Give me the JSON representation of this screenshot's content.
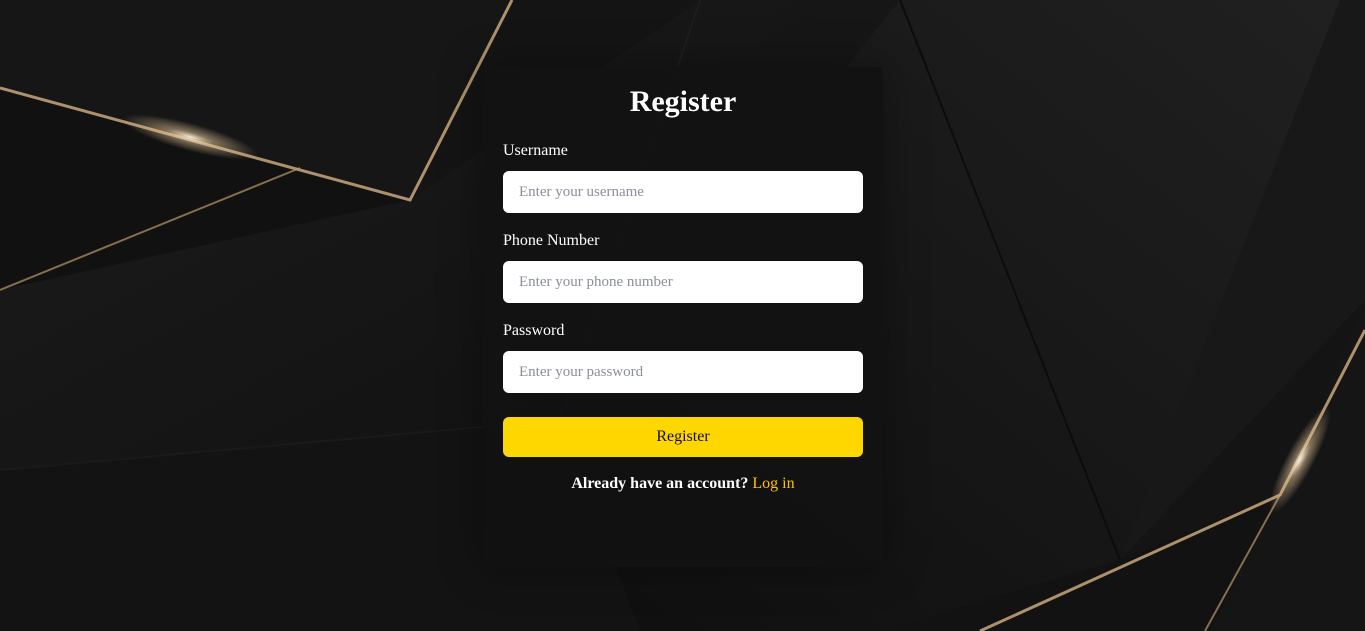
{
  "form": {
    "title": "Register",
    "username": {
      "label": "Username",
      "placeholder": "Enter your username",
      "value": ""
    },
    "phone": {
      "label": "Phone Number",
      "placeholder": "Enter your phone number",
      "value": ""
    },
    "password": {
      "label": "Password",
      "placeholder": "Enter your password",
      "value": ""
    },
    "submit_label": "Register",
    "footer_text": "Already have an account?",
    "login_link": "Log in"
  },
  "colors": {
    "background": "#151515",
    "card": "#121212",
    "accent_button": "#ffd700",
    "link": "#ffc107",
    "gold_line": "#c9a77c"
  }
}
